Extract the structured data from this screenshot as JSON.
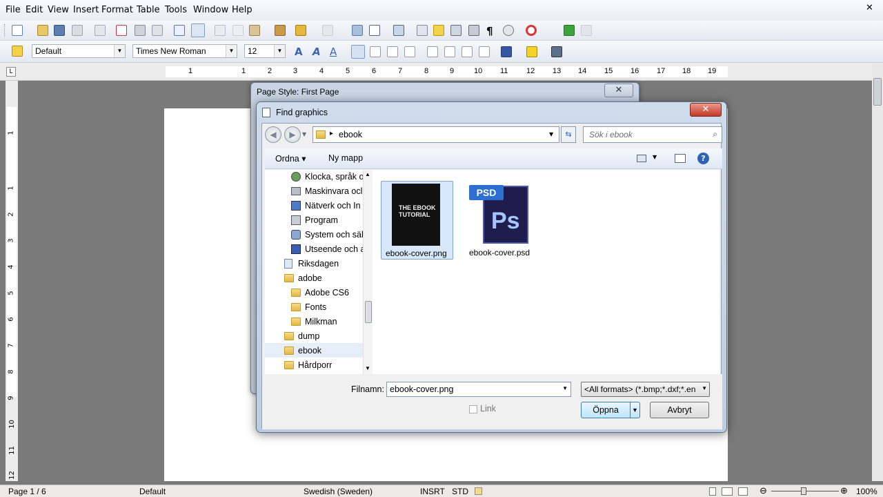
{
  "menu": [
    "File",
    "Edit",
    "View",
    "Insert",
    "Format",
    "Table",
    "Tools",
    "Window",
    "Help"
  ],
  "toolbar": {
    "style": "Default",
    "font": "Times New Roman",
    "size": "12"
  },
  "ruler": {
    "h_ticks": [
      "1",
      "1",
      "2",
      "3",
      "4",
      "5",
      "6",
      "7",
      "8",
      "9",
      "10",
      "11",
      "12",
      "13",
      "14",
      "15",
      "16",
      "17",
      "18",
      "19"
    ],
    "v_ticks": [
      "1",
      "1",
      "2",
      "3",
      "4",
      "5",
      "6",
      "7",
      "8",
      "9",
      "10",
      "11",
      "12"
    ]
  },
  "page_style_dialog": {
    "title": "Page Style: First Page"
  },
  "find_graphics": {
    "title": "Find graphics",
    "address": "ebook",
    "search_placeholder": "Sök i ebook",
    "cmd": {
      "organize": "Ordna",
      "new_folder": "Ny mapp"
    },
    "tree": [
      {
        "label": "Klocka, språk o",
        "indent": 2,
        "icon": "clock-icon"
      },
      {
        "label": "Maskinvara ocl",
        "indent": 2,
        "icon": "printer-icon"
      },
      {
        "label": "Nätverk och In",
        "indent": 2,
        "icon": "network-icon"
      },
      {
        "label": "Program",
        "indent": 2,
        "icon": "program-icon"
      },
      {
        "label": "System och säk",
        "indent": 2,
        "icon": "shield-icon"
      },
      {
        "label": "Utseende och a",
        "indent": 2,
        "icon": "display-icon"
      },
      {
        "label": "Riksdagen",
        "indent": 1,
        "icon": "recycle-bin-icon"
      },
      {
        "label": "adobe",
        "indent": 1,
        "icon": "folder-icon"
      },
      {
        "label": "Adobe CS6",
        "indent": 2,
        "icon": "folder-icon"
      },
      {
        "label": "Fonts",
        "indent": 2,
        "icon": "folder-icon"
      },
      {
        "label": "Milkman",
        "indent": 2,
        "icon": "folder-icon"
      },
      {
        "label": "dump",
        "indent": 1,
        "icon": "folder-icon"
      },
      {
        "label": "ebook",
        "indent": 1,
        "icon": "folder-icon"
      },
      {
        "label": "Hårdporr",
        "indent": 1,
        "icon": "folder-icon"
      }
    ],
    "files": [
      {
        "name": "ebook-cover.png",
        "thumb_text": "THE EBOOK TUTORIAL",
        "selected": true
      },
      {
        "name": "ebook-cover.psd",
        "thumb_text": "Ps",
        "badge": "PSD",
        "selected": false
      }
    ],
    "filename_label": "Filnamn:",
    "filename_value": "ebook-cover.png",
    "filter": "<All formats> (*.bmp;*.dxf;*.en",
    "link_label": "Link",
    "open_label": "Öppna",
    "cancel_label": "Avbryt"
  },
  "status": {
    "page": "Page 1 / 6",
    "style": "Default",
    "language": "Swedish (Sweden)",
    "insert": "INSRT",
    "selection": "STD",
    "zoom": "100%"
  }
}
